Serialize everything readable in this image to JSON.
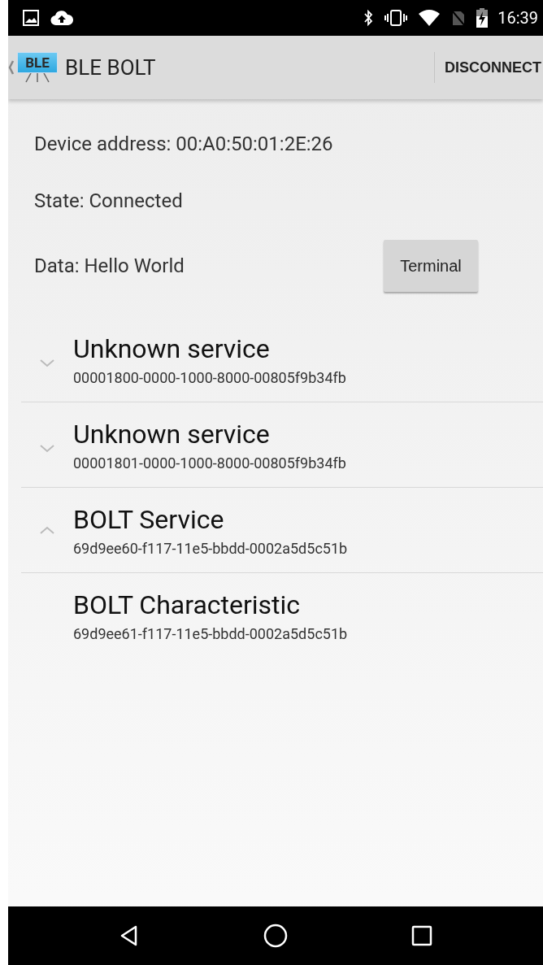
{
  "status_bar": {
    "time": "16:39"
  },
  "app_bar": {
    "title": "BLE BOLT",
    "logo_text": "BLE",
    "action": "DISCONNECT"
  },
  "info": [
    {
      "label": "Device address: 00:A0:50:01:2E:26"
    },
    {
      "label": "State: Connected"
    },
    {
      "label": "Data: Hello World",
      "button": "Terminal"
    }
  ],
  "services": [
    {
      "name": "Unknown service",
      "uuid": "00001800-0000-1000-8000-00805f9b34fb",
      "expanded": false
    },
    {
      "name": "Unknown service",
      "uuid": "00001801-0000-1000-8000-00805f9b34fb",
      "expanded": false
    },
    {
      "name": "BOLT Service",
      "uuid": "69d9ee60-f117-11e5-bbdd-0002a5d5c51b",
      "expanded": true,
      "children": [
        {
          "name": "BOLT Characteristic",
          "uuid": "69d9ee61-f117-11e5-bbdd-0002a5d5c51b"
        }
      ]
    }
  ]
}
